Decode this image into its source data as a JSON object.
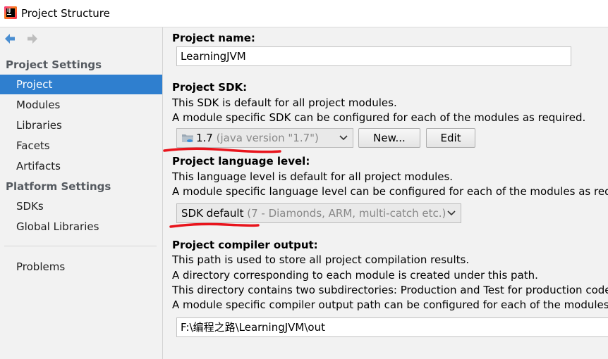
{
  "window": {
    "title": "Project Structure"
  },
  "sidebar": {
    "project_settings_header": "Project Settings",
    "project_settings_items": [
      "Project",
      "Modules",
      "Libraries",
      "Facets",
      "Artifacts"
    ],
    "platform_settings_header": "Platform Settings",
    "platform_settings_items": [
      "SDKs",
      "Global Libraries"
    ],
    "problems": "Problems",
    "selected": "Project"
  },
  "main": {
    "project_name": {
      "title": "Project name:",
      "value": "LearningJVM"
    },
    "project_sdk": {
      "title": "Project SDK:",
      "line1": "This SDK is default for all project modules.",
      "line2": "A module specific SDK can be configured for each of the modules as required.",
      "combo_value": "1.7",
      "combo_detail": "(java version \"1.7\")",
      "new_button": "New...",
      "edit_button": "Edit"
    },
    "language_level": {
      "title": "Project language level:",
      "line1": "This language level is default for all project modules.",
      "line2": "A module specific language level can be configured for each of the modules as required.",
      "combo_value": "SDK default",
      "combo_detail": "(7 - Diamonds, ARM, multi-catch etc.)"
    },
    "compiler_output": {
      "title": "Project compiler output:",
      "line1": "This path is used to store all project compilation results.",
      "line2": "A directory corresponding to each module is created under this path.",
      "line3": "This directory contains two subdirectories: Production and Test for production code and test sources, respectively.",
      "line4": "A module specific compiler output path can be configured for each of the modules as required.",
      "value": "F:\\编程之路\\LearningJVM\\out"
    }
  },
  "colors": {
    "selection": "#2f7fcf",
    "annotation_red": "#e8141c"
  },
  "icons": {
    "back": "arrow-left-icon",
    "forward": "arrow-right-icon",
    "sdk": "jdk-folder-icon",
    "combo": "chevron-down-icon"
  }
}
